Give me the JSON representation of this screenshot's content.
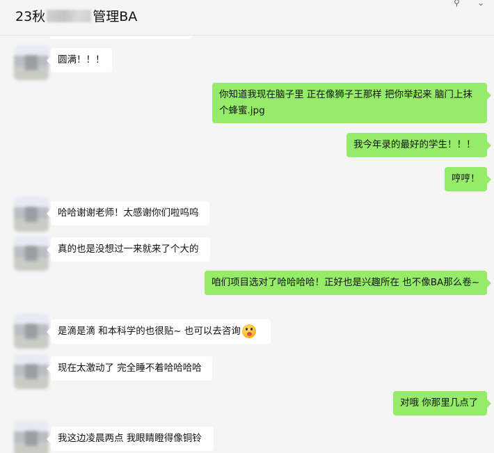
{
  "header": {
    "title_prefix": "23秋",
    "title_suffix": "管理BA",
    "pin_icon": "⚲",
    "more_icon": "⌄"
  },
  "messages": [
    {
      "side": "in",
      "text": "圆满！！！"
    },
    {
      "side": "out",
      "text": "你知道我现在脑子里 正在像狮子王那样 把你举起来 脑门上抹个蜂蜜.jpg"
    },
    {
      "side": "out",
      "text": "我今年录的最好的学生！！！"
    },
    {
      "side": "out",
      "text": "哼哼！"
    },
    {
      "side": "in",
      "text": "哈哈谢谢老师！太感谢你们啦呜呜"
    },
    {
      "side": "in",
      "text": "真的也是没想过一来就来了个大的"
    },
    {
      "side": "out",
      "text": "咱们项目选对了哈哈哈哈！正好也是兴趣所在 也不像BA那么卷~"
    },
    {
      "side": "in",
      "text": "是滴是滴 和本科学的也很贴~ 也可以去咨询"
    },
    {
      "side": "in",
      "text": "现在太激动了 完全睡不着哈哈哈哈"
    },
    {
      "side": "out",
      "text": "对哦 你那里几点了"
    },
    {
      "side": "in",
      "text": "我这边凌晨两点 我眼睛瞪得像铜铃"
    }
  ]
}
